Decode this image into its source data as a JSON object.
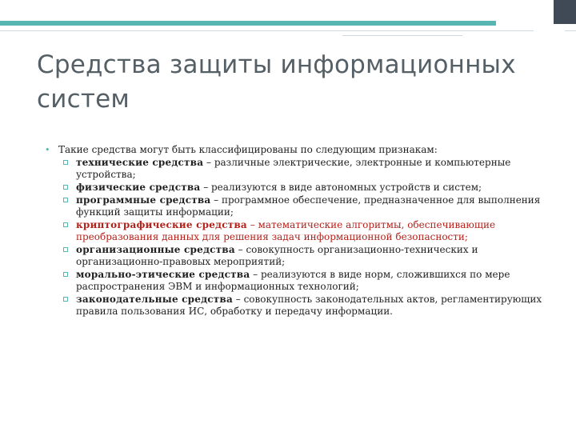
{
  "slide": {
    "title": "Средства защиты информационных систем",
    "intro": "Такие средства могут быть классифицированы по следующим признакам:",
    "items": [
      {
        "term": "технические средства",
        "desc": " – различные электрические, электронные и компьютерные устройства;"
      },
      {
        "term": "физические средства",
        "desc": " – реализуются в виде автономных устройств и систем;"
      },
      {
        "term": "программные средства",
        "desc": " – программное обеспечение, предназначенное для выполнения функций защиты информации;"
      },
      {
        "term": "криптографические средства",
        "desc": " – математические алгоритмы, обеспечивающие преобразования данных для решения задач информационной безопасности;"
      },
      {
        "term": "организационные средства",
        "desc": " – совокупность организационно-технических и организационно-правовых мероприятий;"
      },
      {
        "term": "морально-этические средства",
        "desc": " – реализуются в виде норм, сложившихся по мере распространения ЭВМ и информационных технологий;"
      },
      {
        "term": "законодательные средства",
        "desc": " – совокупность законодательных актов, регламентирующих правила пользования ИС, обработку и передачу информации."
      }
    ]
  },
  "colors": {
    "accent": "#58b6b2",
    "dark": "#3f4a56",
    "highlight": "#b3221b",
    "title": "#555f66"
  },
  "icons": {
    "lead_bullet": "•"
  }
}
